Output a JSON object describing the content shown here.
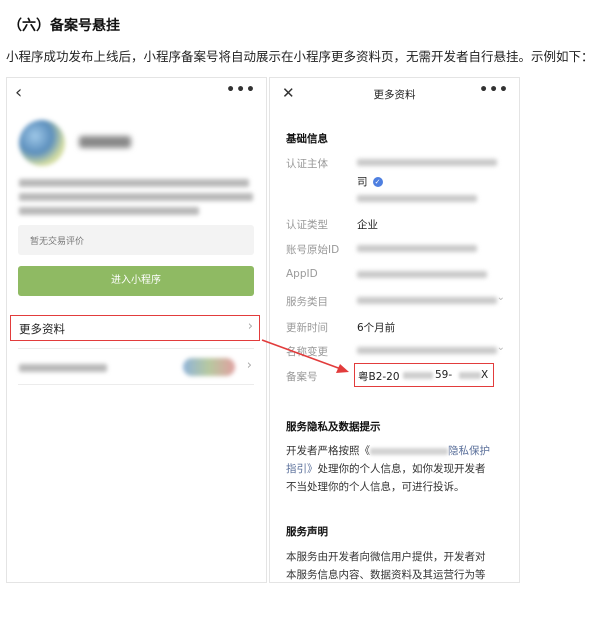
{
  "doc": {
    "heading": "（六）备案号悬挂",
    "intro": "小程序成功发布上线后，小程序备案号将自动展示在小程序更多资料页，无需开发者自行悬挂。示例如下："
  },
  "left_panel": {
    "back_icon": "‹",
    "menu_icon": "•••",
    "rating_placeholder": "暂无交易评价",
    "enter_button": "进入小程序",
    "more_info_label": "更多资料",
    "chevron": "›"
  },
  "right_panel": {
    "close_icon": "✕",
    "title": "更多资料",
    "menu_icon": "•••",
    "basic_section": "基础信息",
    "fields": {
      "subject_label": "认证主体",
      "subject_value_tail": "司",
      "type_label": "认证类型",
      "type_value": "企业",
      "origin_id_label": "账号原始ID",
      "appid_label": "AppID",
      "category_label": "服务类目",
      "update_label": "更新时间",
      "update_value": "6个月前",
      "name_change_label": "名称变更",
      "record_label": "备案号",
      "record_part1": "粤B2-20",
      "record_part2": "59-",
      "record_part3": "X"
    },
    "privacy_section": "服务隐私及数据提示",
    "privacy_text_start": "开发者严格按照《",
    "privacy_link_tail": "隐私保护",
    "privacy_link_line2": "指引》",
    "privacy_text_rest": "处理你的个人信息，如你发现开发者",
    "privacy_text_line3": "不当处理你的个人信息，可进行投诉。",
    "statement_section": "服务声明",
    "statement_line1": "本服务由开发者向微信用户提供，开发者对",
    "statement_line2": "本服务信息内容、数据资料及其运营行为等"
  },
  "colors": {
    "highlight_red": "#e23c3c",
    "enter_green": "#8fba63",
    "link_blue": "#5a6f9a"
  }
}
